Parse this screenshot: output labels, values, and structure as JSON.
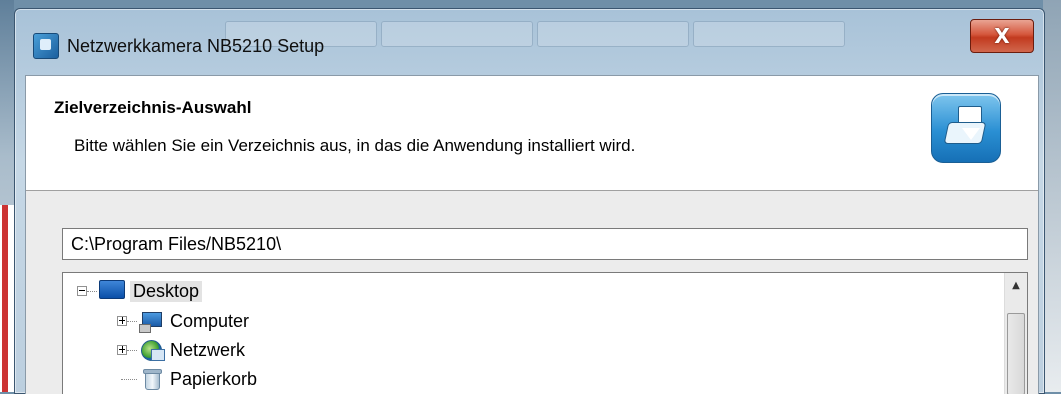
{
  "window": {
    "title": "Netzwerkkamera NB5210 Setup",
    "close_label": "X"
  },
  "header": {
    "title": "Zielverzeichnis-Auswahl",
    "subtitle": "Bitte wählen Sie ein Verzeichnis aus, in das die Anwendung installiert wird."
  },
  "path_field": {
    "value": "C:\\Program Files/NB5210\\"
  },
  "tree": {
    "items": [
      {
        "label": "Desktop",
        "icon": "desktop-icon",
        "expander": "minus"
      },
      {
        "label": "Computer",
        "icon": "computer-icon",
        "expander": "plus"
      },
      {
        "label": "Netzwerk",
        "icon": "network-icon",
        "expander": "plus"
      },
      {
        "label": "Papierkorb",
        "icon": "recycle-bin-icon",
        "expander": "none"
      }
    ]
  },
  "colors": {
    "close_button": "#c23a1f",
    "header_bg": "#ffffff",
    "client_bg": "#ececec"
  }
}
